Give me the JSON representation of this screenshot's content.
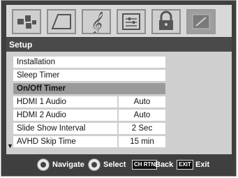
{
  "icons": [
    "picture-icon",
    "audio-icon",
    "music-note-icon",
    "preferences-icon",
    "lock-icon",
    "setup-icon"
  ],
  "panel": {
    "title": "Setup",
    "items": [
      {
        "label": "Installation"
      },
      {
        "label": "Sleep Timer"
      },
      {
        "label": "On/Off Timer",
        "selected": true
      },
      {
        "label": "HDMI 1 Audio",
        "value": "Auto"
      },
      {
        "label": "HDMI 2 Audio",
        "value": "Auto"
      },
      {
        "label": "Slide Show Interval",
        "value": "2 Sec"
      },
      {
        "label": "AVHD Skip Time",
        "value": "15 min"
      }
    ]
  },
  "footer": {
    "navigate": "Navigate",
    "select": "Select",
    "back_key": "CH RTN",
    "back": "Back",
    "exit_key": "EXIT",
    "exit": "Exit"
  }
}
